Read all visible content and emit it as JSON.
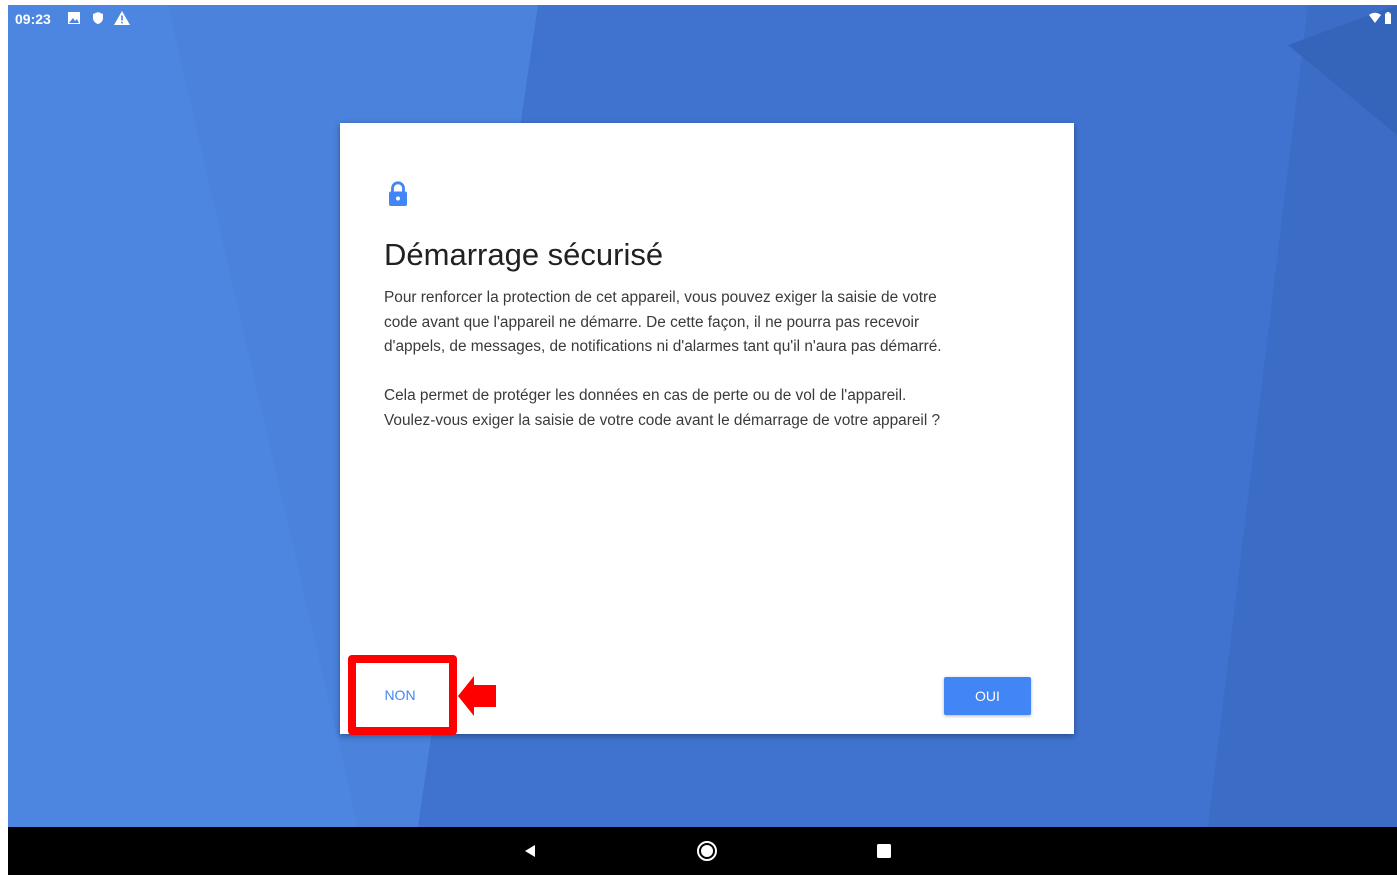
{
  "status_bar": {
    "time": "09:23",
    "left_icons": [
      "image-icon",
      "shield-icon",
      "warning-icon"
    ],
    "right_icons": [
      "wifi-icon",
      "battery-icon"
    ]
  },
  "dialog": {
    "icon": "lock-icon",
    "title": "Démarrage sécurisé",
    "paragraph1_lines": [
      "Pour renforcer la protection de cet appareil, vous pouvez exiger la saisie de votre",
      "code avant que l'appareil ne démarre. De cette façon, il ne pourra pas recevoir",
      "d'appels, de messages, de notifications ni d'alarmes tant qu'il n'aura pas démarré."
    ],
    "paragraph2_lines": [
      "Cela permet de protéger les données en cas de perte ou de vol de l'appareil.",
      "Voulez-vous exiger la saisie de votre code avant le démarrage de votre appareil ?"
    ],
    "negative_button": "NON",
    "positive_button": "OUI"
  },
  "navigation": {
    "back": "back-icon",
    "home": "home-icon",
    "recents": "recents-icon"
  },
  "colors": {
    "accent": "#4285f4",
    "wallpaper": "#4278d3",
    "highlight": "#ff0000"
  }
}
